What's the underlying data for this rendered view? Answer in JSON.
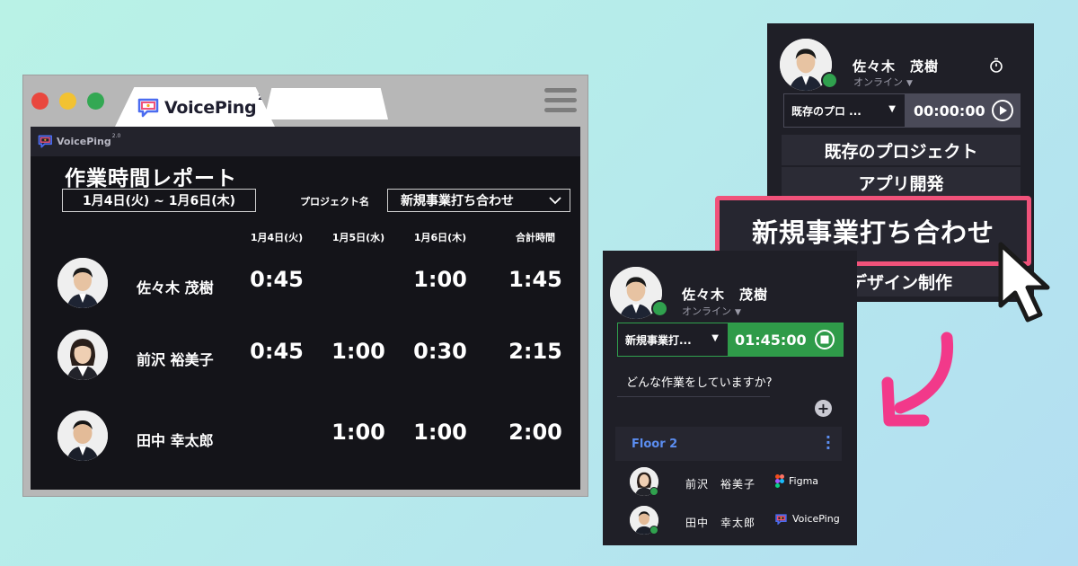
{
  "brand": {
    "name": "VoicePing",
    "version": "2.0",
    "colors": {
      "accent_pink": "#f0527a",
      "online_green": "#30a14e",
      "floor_blue": "#5b8df0",
      "panel_bg": "#1f1f27"
    }
  },
  "report": {
    "title": "作業時間レポート",
    "date_range": "1月4日(火) ~ 1月6日(木)",
    "project_label": "プロジェクト名",
    "project_selected": "新規事業打ち合わせ",
    "columns": [
      "1月4日(火)",
      "1月5日(水)",
      "1月6日(木)",
      "合計時間"
    ],
    "rows": [
      {
        "name": "佐々木 茂樹",
        "values": [
          "0:45",
          "",
          "1:00",
          "1:45"
        ]
      },
      {
        "name": "前沢 裕美子",
        "values": [
          "0:45",
          "1:00",
          "0:30",
          "2:15"
        ]
      },
      {
        "name": "田中 幸太郎",
        "values": [
          "",
          "1:00",
          "1:00",
          "2:00"
        ]
      }
    ]
  },
  "project_panel": {
    "user_name": "佐々木　茂樹",
    "status": "オンライン",
    "selected_project": "既存のプロ ...",
    "timer": "00:00:00",
    "options": [
      "既存のプロジェクト",
      "アプリ開発",
      "新規事業打ち合わせ",
      "デザイン制作"
    ]
  },
  "tracking_panel": {
    "user_name": "佐々木　茂樹",
    "status": "オンライン",
    "selected_project": "新規事業打...",
    "timer": "01:45:00",
    "prompt": "どんな作業をしていますか?",
    "floor": "Floor 2",
    "members": [
      {
        "name": "前沢　裕美子",
        "app": "Figma",
        "app_icon": "figma-icon"
      },
      {
        "name": "田中　幸太郎",
        "app": "VoicePing",
        "app_icon": "voiceping-icon"
      }
    ]
  }
}
